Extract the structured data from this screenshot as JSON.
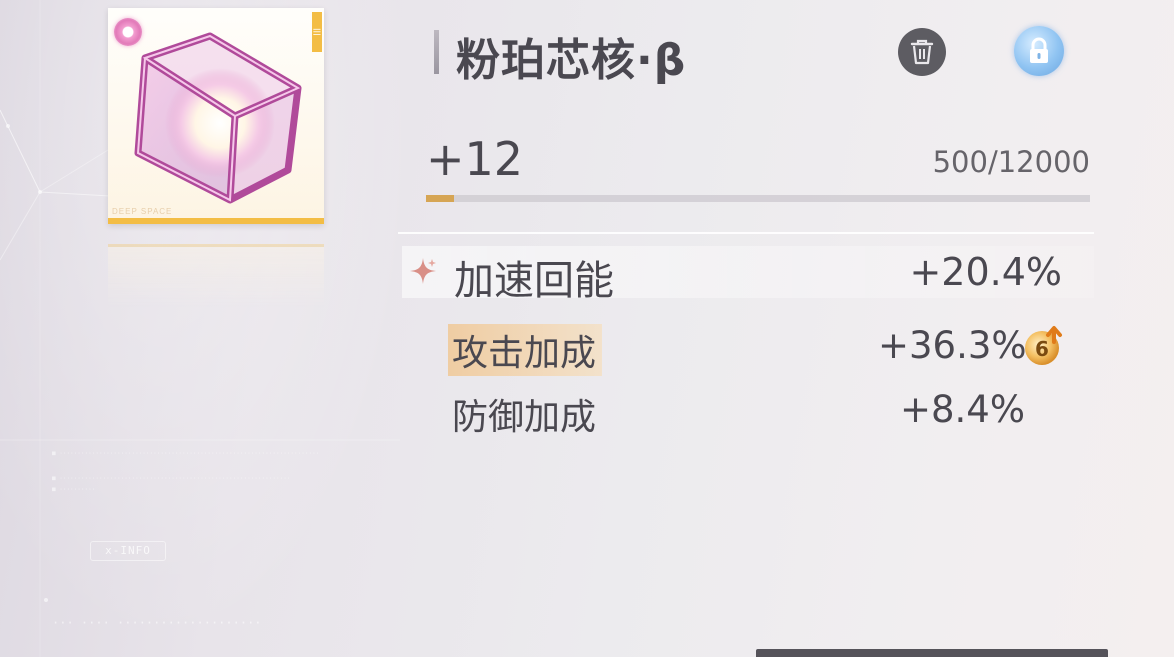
{
  "item": {
    "name": "粉珀芯核·β",
    "image": "cube-core-icon",
    "card_label": "DEEP SPACE",
    "level": "+12",
    "exp_text": "500/12000",
    "exp_progress": 0.042
  },
  "actions": {
    "discard": "trash-icon",
    "lock": "lock-icon"
  },
  "main_stat": {
    "name": "加速回能",
    "value": "+20.4%",
    "icon": "sparkle-icon"
  },
  "sub_stats": [
    {
      "name": "攻击加成",
      "value": "+36.3%",
      "highlighted": true,
      "upgrade_count": "6"
    },
    {
      "name": "防御加成",
      "value": "+8.4%",
      "highlighted": false
    }
  ],
  "background": {
    "info_tag": "x-INFO"
  },
  "colors": {
    "accent_gold": "#d6a554",
    "rarity_gold": "#f3bd45",
    "highlight": "#f0c896",
    "text": "#4a4850",
    "lock_blue": "#90c4f2"
  }
}
